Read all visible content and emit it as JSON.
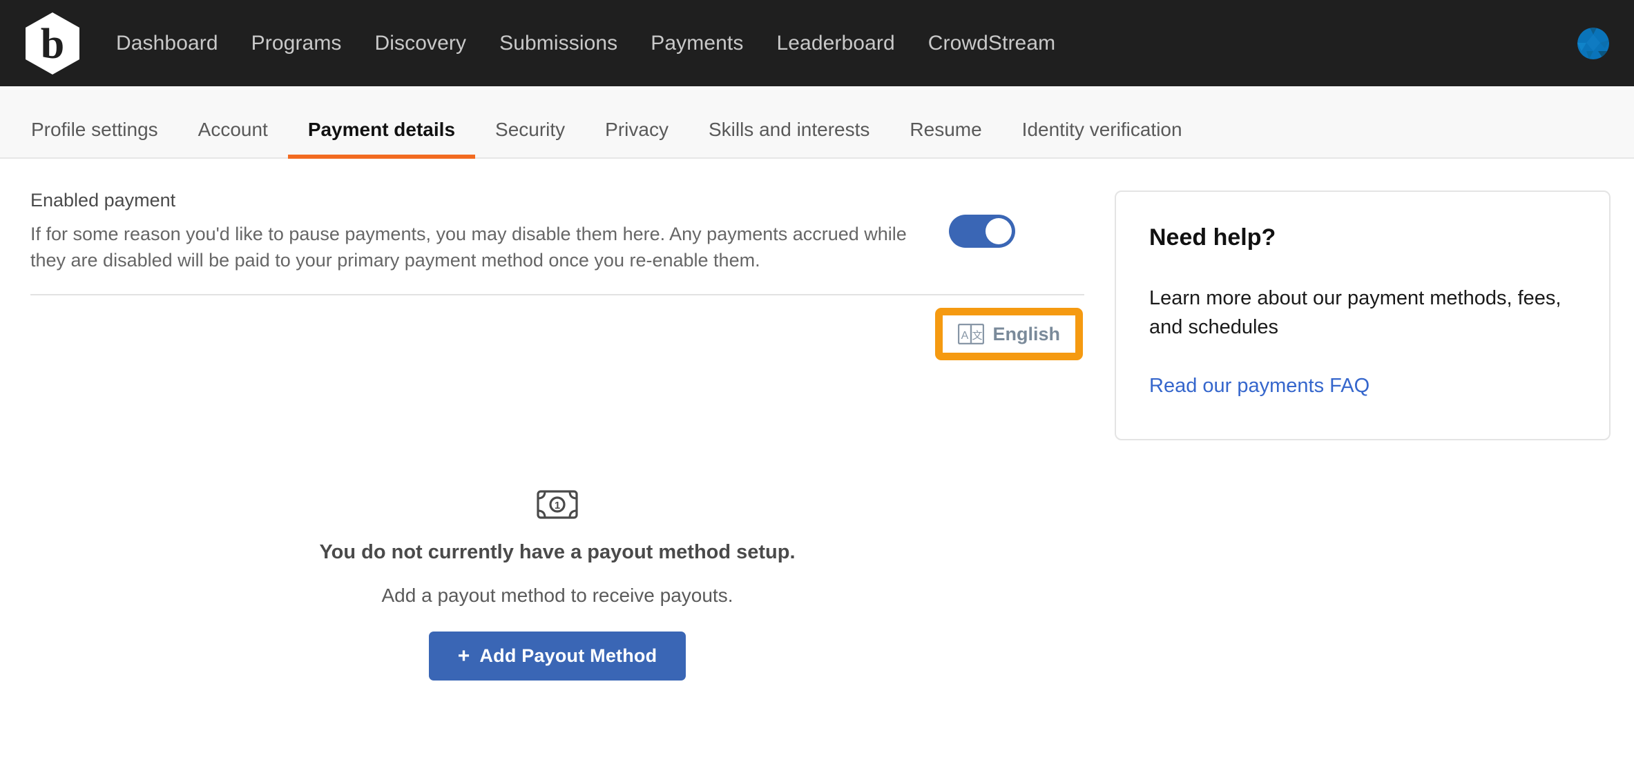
{
  "brand": {
    "logo_icon": "bugcrowd-hexagon-b-logo",
    "accent_orange": "#f26b21",
    "accent_blue": "#3a66b5",
    "nav_bg": "#1f1f1f"
  },
  "topnav": {
    "links": [
      {
        "label": "Dashboard"
      },
      {
        "label": "Programs"
      },
      {
        "label": "Discovery"
      },
      {
        "label": "Submissions"
      },
      {
        "label": "Payments"
      },
      {
        "label": "Leaderboard"
      },
      {
        "label": "CrowdStream"
      }
    ],
    "avatar_icon": "user-avatar"
  },
  "tabs": [
    {
      "label": "Profile settings",
      "active": false
    },
    {
      "label": "Account",
      "active": false
    },
    {
      "label": "Payment details",
      "active": true
    },
    {
      "label": "Security",
      "active": false
    },
    {
      "label": "Privacy",
      "active": false
    },
    {
      "label": "Skills and interests",
      "active": false
    },
    {
      "label": "Resume",
      "active": false
    },
    {
      "label": "Identity verification",
      "active": false
    }
  ],
  "enabled_payment": {
    "title": "Enabled payment",
    "description": "If for some reason you'd like to pause payments, you may disable them here. Any payments accrued while they are disabled will be paid to your primary payment method once you re-enable them.",
    "toggle_state": "on"
  },
  "language_selector": {
    "label": "English",
    "icon": "translate-icon",
    "highlighted": true,
    "highlight_color": "#f59a11"
  },
  "empty_state": {
    "icon": "banknote-icon",
    "title": "You do not currently have a payout method setup.",
    "subtitle": "Add a payout method to receive payouts.",
    "button_plus": "+",
    "button_label": "Add Payout Method"
  },
  "help_card": {
    "title": "Need help?",
    "text": "Learn more about our payment methods, fees, and schedules",
    "link_label": "Read our payments FAQ"
  }
}
